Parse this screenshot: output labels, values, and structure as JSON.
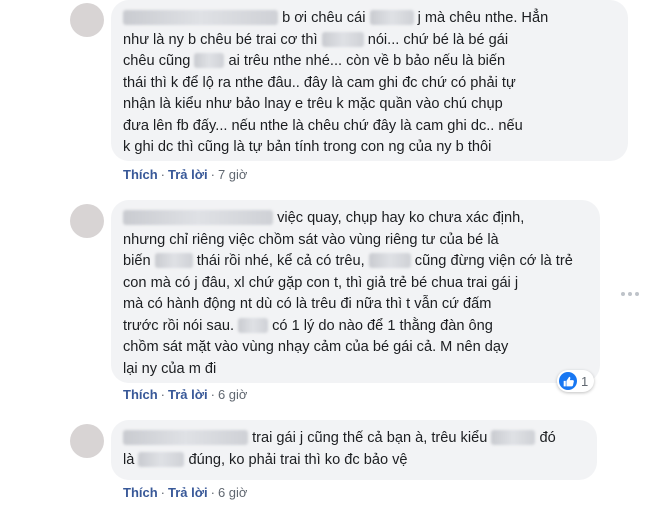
{
  "comments": [
    {
      "lines": [
        [
          "",
          "b ơi chêu cái",
          "",
          "j mà chêu nthe. Hẳn"
        ],
        [
          "như là ny b chêu bé trai cơ thì",
          "",
          "nói... chứ bé là bé gái"
        ],
        [
          "chêu cũng",
          "",
          "ai trêu nthe nhé... còn về b bảo nếu là biến"
        ],
        [
          "thái thì k để lộ ra nthe đâu.. đây là cam ghi đc chứ có phải tự"
        ],
        [
          "nhận là kiểu như bảo lnay e trêu k mặc quần vào chú chụp"
        ],
        [
          "đưa lên fb đấy... nếu nthe là chêu chứ đây là cam ghi dc.. nếu"
        ],
        [
          "k ghi dc thì cũng là tự bản tính trong con ng của ny b thôi"
        ]
      ],
      "actions": {
        "like": "Thích",
        "reply": "Trả lời",
        "time": "7 giờ"
      }
    },
    {
      "lines": [
        [
          "",
          "việc quay, chụp hay ko chưa xác định,"
        ],
        [
          "nhưng chỉ riêng việc chồm sát vào vùng riêng tư của bé là"
        ],
        [
          "biến",
          "",
          "thái rồi nhé, kể cả có trêu,",
          "",
          "cũng đừng viện cớ là trẻ"
        ],
        [
          "con mà có j đâu, xl chứ gặp con t, thì giả trẻ bé chua trai gái j"
        ],
        [
          "mà có hành động nt dù có là trêu đi nữa thì t vẫn cứ đấm"
        ],
        [
          "trước rồi nói sau.",
          "",
          "có 1 lý do nào để 1 thằng đàn ông"
        ],
        [
          "chồm sát mặt vào vùng nhạy cảm của bé gái cả. M nên dạy"
        ],
        [
          "lại ny của m đi"
        ]
      ],
      "reaction_count": "1",
      "actions": {
        "like": "Thích",
        "reply": "Trả lời",
        "time": "6 giờ"
      }
    },
    {
      "lines": [
        [
          "",
          "trai gái j cũng thế cả bạn à, trêu kiểu",
          "",
          "đó"
        ],
        [
          "là",
          "",
          "đúng, ko phải trai thì ko đc bảo vệ"
        ]
      ],
      "actions": {
        "like": "Thích",
        "reply": "Trả lời",
        "time": "6 giờ"
      }
    }
  ],
  "separator": "·",
  "colors": {
    "bubble": "#f2f3f5",
    "link": "#385898",
    "meta": "#606770",
    "like_blue": "#1877f2"
  },
  "icons": {
    "reaction": "like-thumb-icon",
    "more": "more-options-icon"
  }
}
